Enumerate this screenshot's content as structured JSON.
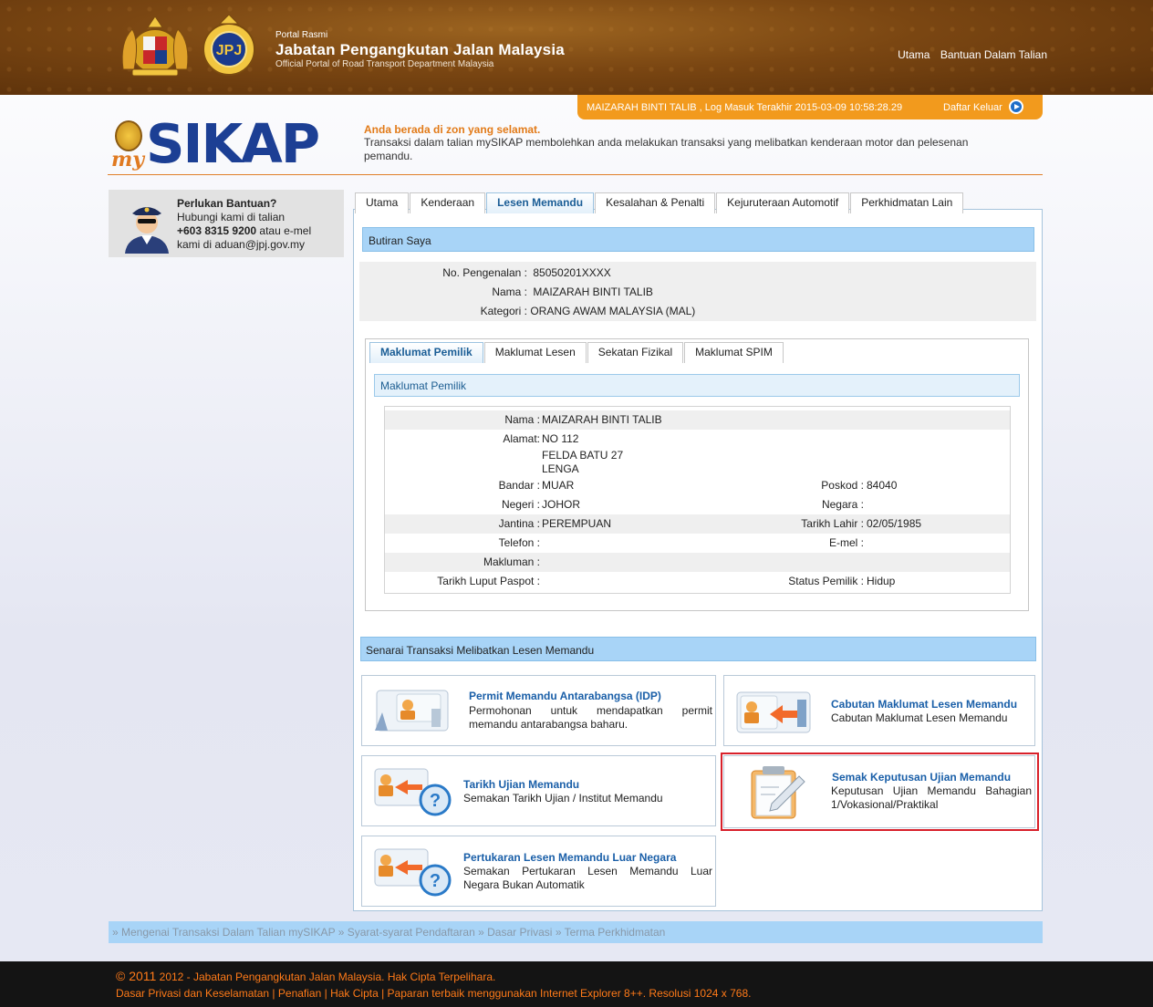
{
  "header": {
    "portal_small": "Portal Rasmi",
    "portal_title": "Jabatan Pengangkutan Jalan Malaysia",
    "portal_english": "Official Portal of Road Transport Department Malaysia",
    "nav": [
      "Utama",
      "Bantuan Dalam Talian"
    ]
  },
  "login": {
    "status": "MAIZARAH BINTI TALIB , Log Masuk Terakhir 2015-03-09 10:58:28.29",
    "logout": "Daftar Keluar"
  },
  "logo": {
    "my": "my",
    "sikap": "SIKAP"
  },
  "safe_zone": {
    "title": "Anda berada di zon yang selamat.",
    "desc": "Transaksi dalam talian mySIKAP membolehkan anda melakukan transaksi yang melibatkan kenderaan motor dan pelesenan pemandu."
  },
  "help": {
    "title": "Perlukan Bantuan?",
    "line1": "Hubungi kami di talian",
    "phone": "+603 8315 9200",
    "line2_suffix": " atau e-mel",
    "line3": "kami di aduan@jpj.gov.my"
  },
  "tabs": [
    "Utama",
    "Kenderaan",
    "Lesen Memandu",
    "Kesalahan & Penalti",
    "Kejuruteraan Automotif",
    "Perkhidmatan Lain"
  ],
  "active_tab": "Lesen Memandu",
  "butiran": {
    "title": "Butiran Saya",
    "rows": [
      {
        "label": "No. Pengenalan :",
        "value": "85050201XXXX"
      },
      {
        "label": "Nama :",
        "value": "MAIZARAH BINTI TALIB"
      },
      {
        "label": "Kategori :",
        "value": "ORANG AWAM MALAYSIA (MAL)"
      }
    ]
  },
  "inner_tabs": [
    "Maklumat Pemilik",
    "Maklumat Lesen",
    "Sekatan Fizikal",
    "Maklumat SPIM"
  ],
  "pemilik": {
    "title": "Maklumat Pemilik",
    "nama_label": "Nama :",
    "nama": "MAIZARAH BINTI TALIB",
    "alamat_label": "Alamat:",
    "alamat1": "NO 112",
    "alamat2": "FELDA BATU 27",
    "alamat3": "LENGA",
    "bandar_label": "Bandar :",
    "bandar": "MUAR",
    "poskod_label": "Poskod :",
    "poskod": "84040",
    "negeri_label": "Negeri :",
    "negeri": "JOHOR",
    "negara_label": "Negara :",
    "negara": "",
    "jantina_label": "Jantina :",
    "jantina": "PEREMPUAN",
    "lahir_label": "Tarikh Lahir :",
    "lahir": "02/05/1985",
    "telefon_label": "Telefon :",
    "telefon": "",
    "emel_label": "E-mel :",
    "emel": "",
    "makluman_label": "Makluman :",
    "makluman": "",
    "paspot_label": "Tarikh Luput Paspot :",
    "paspot": "",
    "status_label": "Status Pemilik :",
    "status": "Hidup"
  },
  "senarai": {
    "title": "Senarai Transaksi Melibatkan Lesen Memandu"
  },
  "cards": {
    "idp": {
      "title": "Permit Memandu Antarabangsa (IDP)",
      "desc": "Permohonan untuk mendapatkan permit memandu antarabangsa baharu."
    },
    "cabutan": {
      "title": "Cabutan Maklumat Lesen Memandu",
      "desc": "Cabutan Maklumat Lesen Memandu"
    },
    "tarikh": {
      "title": "Tarikh Ujian Memandu",
      "desc": "Semakan Tarikh Ujian / Institut Memandu"
    },
    "semak": {
      "title": "Semak Keputusan Ujian Memandu",
      "desc": "Keputusan Ujian Memandu Bahagian 1/Vokasional/Praktikal"
    },
    "pertukaran": {
      "title": "Pertukaran Lesen Memandu Luar Negara",
      "desc": "Semakan Pertukaran Lesen Memandu Luar Negara Bukan Automatik"
    }
  },
  "footer_links": [
    "Mengenai Transaksi Dalam Talian mySIKAP",
    "Syarat-syarat Pendaftaran",
    "Dasar Privasi",
    "Terma Perkhidmatan"
  ],
  "footer": {
    "copyright_year": "© 2011",
    "copyright": " 2012 - Jabatan Pengangkutan Jalan Malaysia. Hak Cipta Terpelihara.",
    "links": [
      "Dasar Privasi dan Keselamatan",
      "Penafian",
      "Hak Cipta"
    ],
    "note": "Paparan terbaik menggunakan Internet Explorer 8++. Resolusi 1024 x 768."
  },
  "colors": {
    "accent_orange": "#f29a1d",
    "brand_blue": "#1c3f94",
    "link_blue": "#1a5fa8",
    "bar_blue": "#a8d4f7",
    "highlight_red": "#d8202a"
  }
}
